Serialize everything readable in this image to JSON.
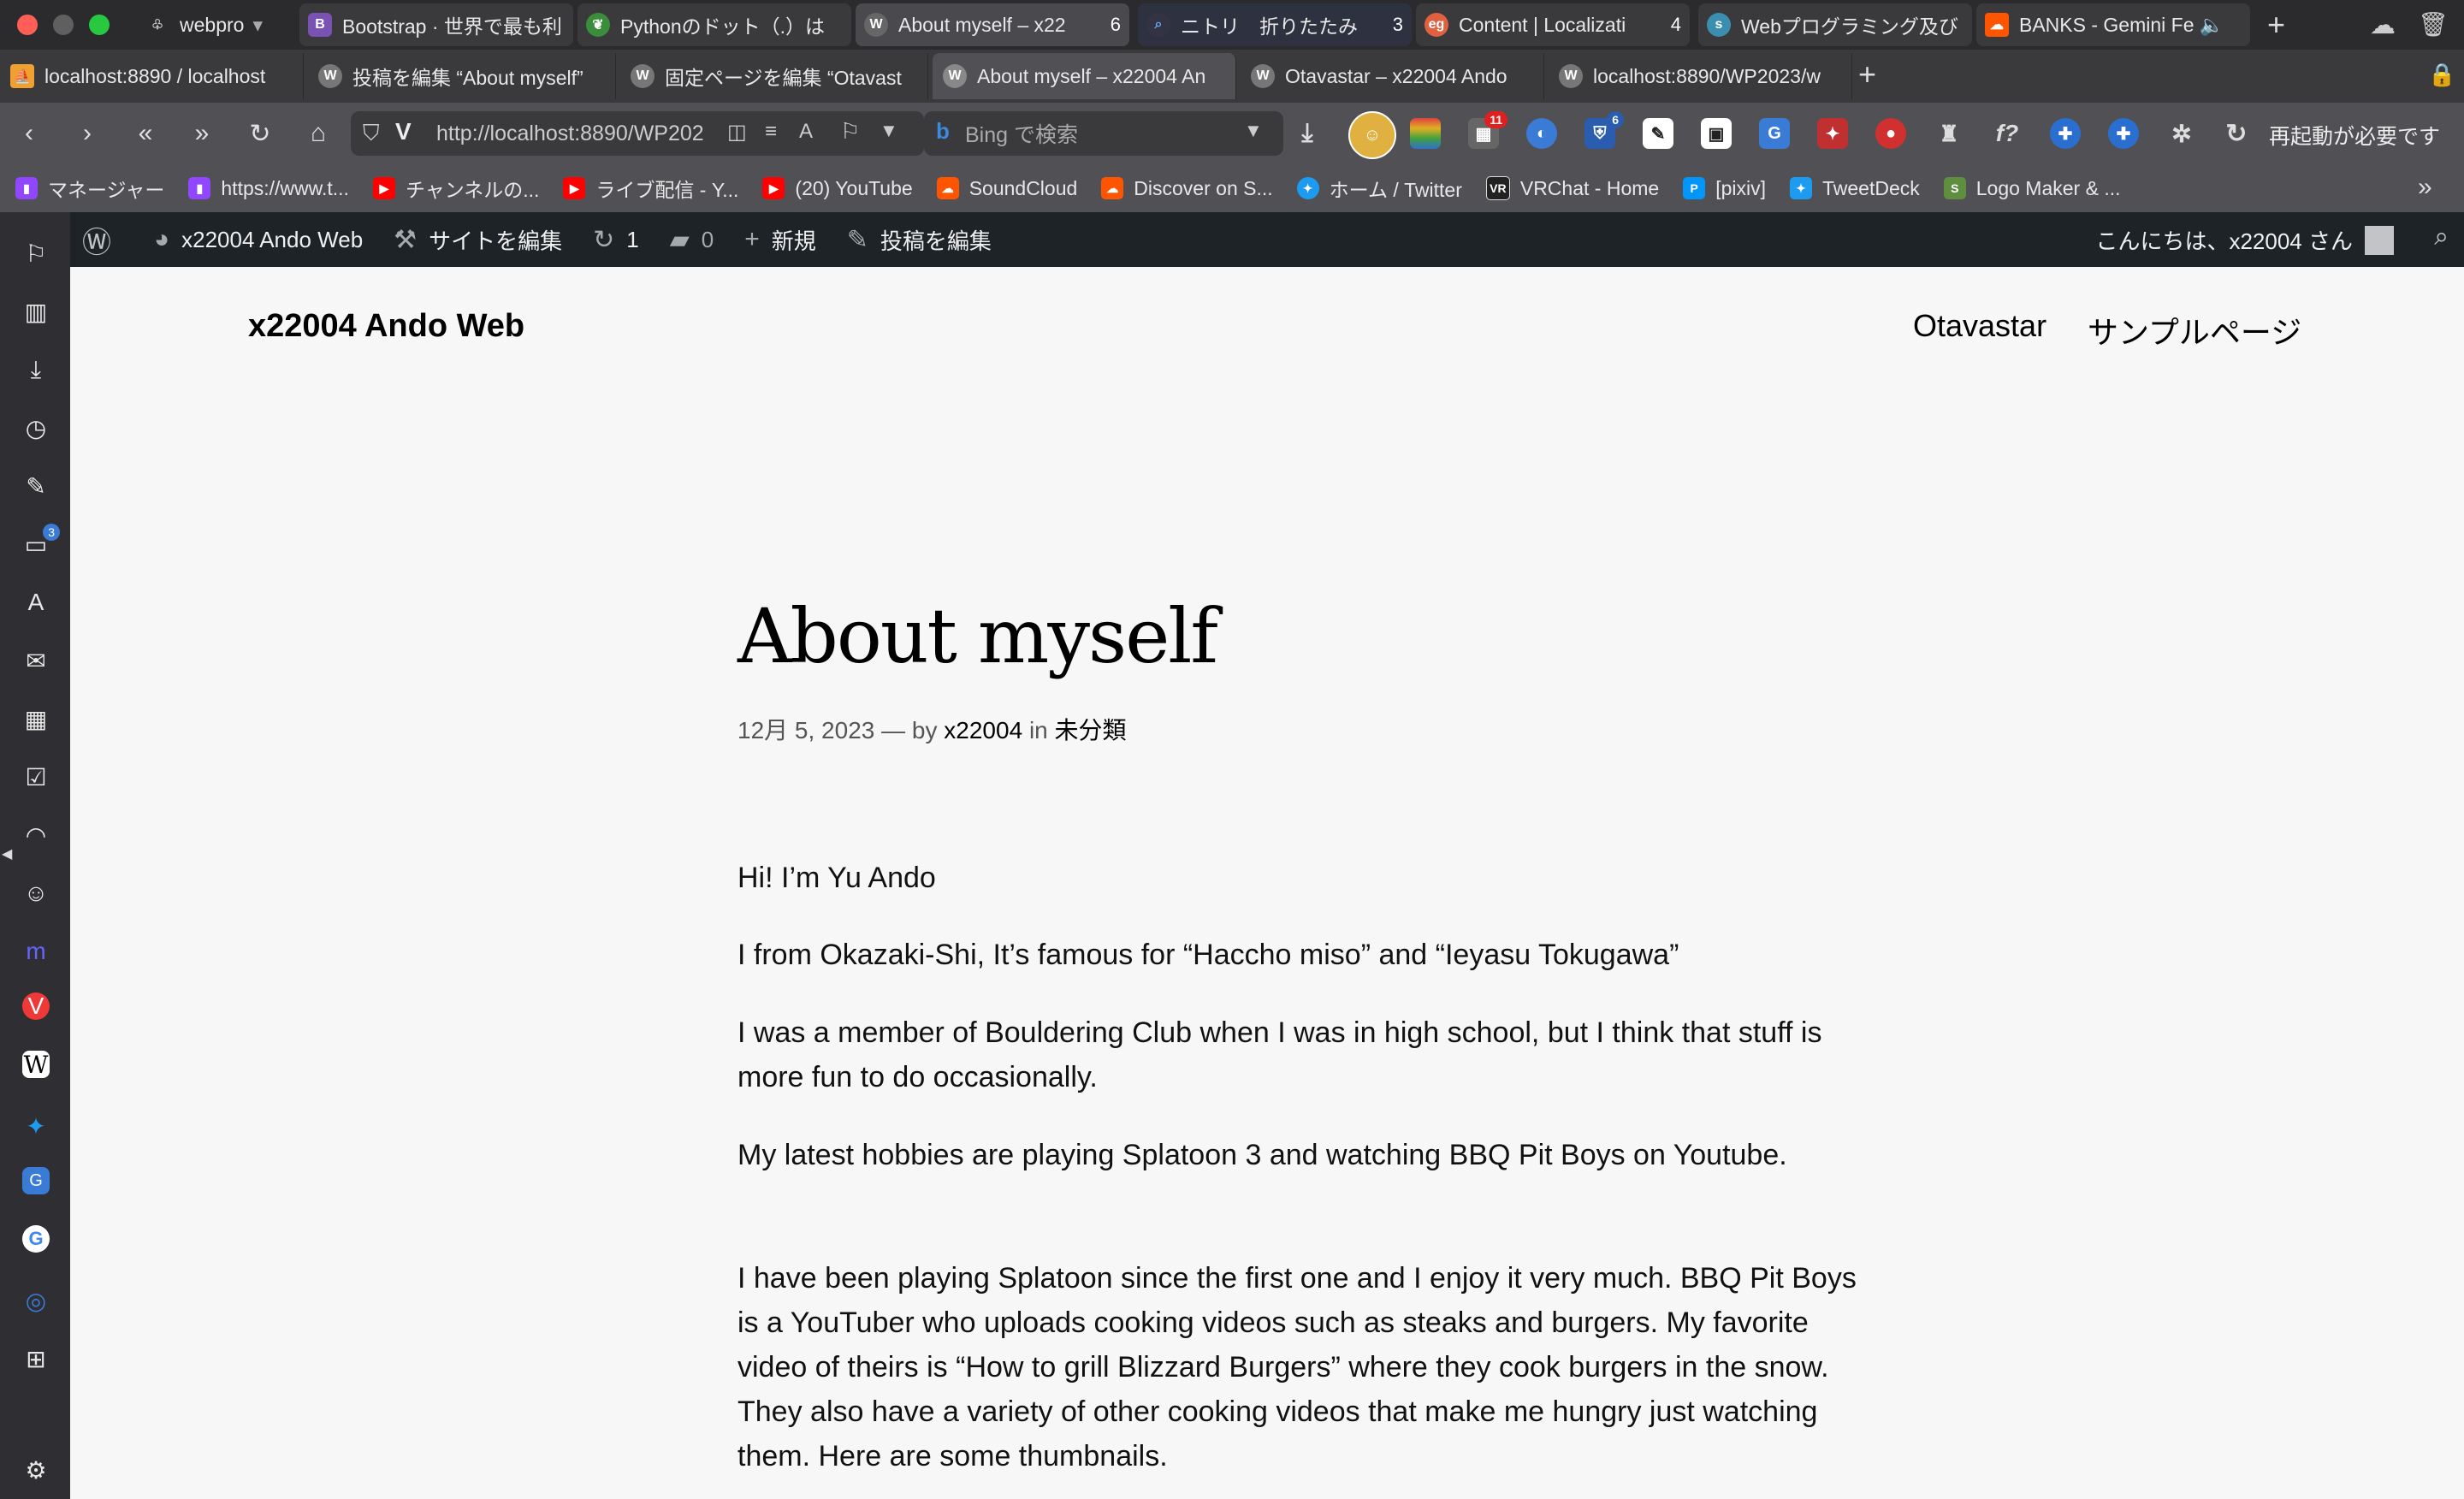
{
  "tabs_row1": [
    {
      "label": "webpro",
      "icon": "tree-icon",
      "color": "#2b2b2e"
    },
    {
      "label": "Bootstrap · 世界で最も利",
      "icon": "bootstrap-icon",
      "color": "#7952b3"
    },
    {
      "label": "Pythonのドット（.）は",
      "icon": "leaf-icon",
      "color": "#3a8d3a"
    },
    {
      "label": "About myself – x22",
      "icon": "wordpress-icon",
      "color": "#555",
      "count": "6"
    },
    {
      "label": "ニトリ　折りたたみ",
      "icon": "search-icon",
      "color": "#334",
      "count": "3"
    },
    {
      "label": "Content | Localizati",
      "icon": "eg-icon",
      "color": "#e06040",
      "count": "4"
    },
    {
      "label": "Webプログラミング及び",
      "icon": "s-icon",
      "color": "#3a8fb0"
    },
    {
      "label": "BANKS - Gemini Fe",
      "icon": "soundcloud-icon",
      "color": "#ff5500"
    }
  ],
  "tabs_row2": [
    {
      "label": "localhost:8890 / localhost",
      "icon": "phpmyadmin-icon"
    },
    {
      "label": "投稿を編集 “About myself”",
      "icon": "wordpress-icon"
    },
    {
      "label": "固定ページを編集 “Otavast",
      "icon": "wordpress-icon"
    },
    {
      "label": "About myself – x22004 An",
      "icon": "wordpress-icon",
      "active": true
    },
    {
      "label": "Otavastar – x22004 Ando",
      "icon": "wordpress-icon"
    },
    {
      "label": "localhost:8890/WP2023/w",
      "icon": "wordpress-icon"
    }
  ],
  "address": {
    "url": "http://localhost:8890/WP202",
    "search_placeholder": "Bing で検索",
    "restart_label": "再起動が必要です"
  },
  "extension_badges": {
    "ext1": "11",
    "ext2": "6"
  },
  "bookmarks": [
    {
      "label": "マネージャー",
      "icon": "twitch-icon",
      "color": "#9146ff"
    },
    {
      "label": "https://www.t...",
      "icon": "twitch-icon",
      "color": "#9146ff"
    },
    {
      "label": "チャンネルの...",
      "icon": "youtube-icon",
      "color": "#ff0000"
    },
    {
      "label": "ライブ配信 - Y...",
      "icon": "youtube-icon",
      "color": "#ff0000"
    },
    {
      "label": "(20) YouTube",
      "icon": "youtube-icon",
      "color": "#ff0000"
    },
    {
      "label": "SoundCloud",
      "icon": "soundcloud-icon",
      "color": "#ff5500"
    },
    {
      "label": "Discover on S...",
      "icon": "soundcloud-icon",
      "color": "#ff5500"
    },
    {
      "label": "ホーム / Twitter",
      "icon": "twitter-icon",
      "color": "#1d9bf0"
    },
    {
      "label": "VRChat - Home",
      "icon": "vrchat-icon",
      "color": "#222"
    },
    {
      "label": "[pixiv]",
      "icon": "pixiv-icon",
      "color": "#0096fa"
    },
    {
      "label": "TweetDeck",
      "icon": "tweetdeck-icon",
      "color": "#1d9bf0"
    },
    {
      "label": "Logo Maker & ...",
      "icon": "shopify-icon",
      "color": "#5e8e3e"
    }
  ],
  "sidepanel": {
    "badge": "3"
  },
  "adminbar": {
    "site": "x22004 Ando Web",
    "edit_site": "サイトを編集",
    "updates": "1",
    "comments": "0",
    "new": "新規",
    "edit_post": "投稿を編集",
    "greeting": "こんにちは、x22004 さん"
  },
  "page": {
    "site_title": "x22004 Ando Web",
    "nav": [
      "Otavastar",
      "サンプルページ"
    ],
    "post_title": "About myself",
    "meta": {
      "date": "12月 5, 2023",
      "sep": "— by",
      "author": "x22004",
      "in": "in",
      "category": "未分類"
    },
    "paragraphs": [
      "Hi! I’m Yu Ando",
      "I from Okazaki-Shi, It’s famous for “Haccho miso” and “Ieyasu Tokugawa”",
      "I was a member of Bouldering Club when I was in high school, but I think that stuff is more fun to do occasionally.",
      "My latest hobbies are playing Splatoon 3 and watching BBQ Pit Boys on Youtube.",
      "I have been playing Splatoon since the first one and I enjoy it very much. BBQ Pit Boys is a YouTuber who uploads cooking videos such as steaks and burgers. My favorite video of theirs is “How to grill Blizzard Burgers” where they cook burgers in the snow. They also have a variety of other cooking videos that make me hungry just watching them. Here are some thumbnails."
    ]
  }
}
